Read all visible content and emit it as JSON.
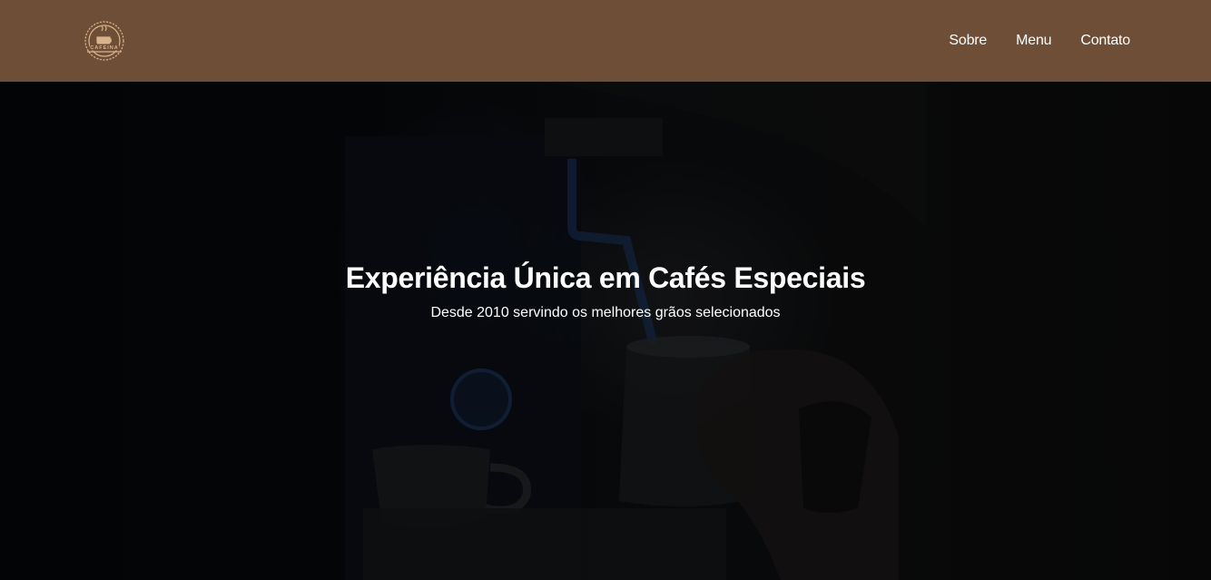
{
  "navbar": {
    "logo_icon": "cafeina-coffee-cup-badge-icon",
    "logo_text": "CAFEINA",
    "links": [
      {
        "label": "Sobre"
      },
      {
        "label": "Menu"
      },
      {
        "label": "Contato"
      }
    ],
    "background_color": "#6f4e37"
  },
  "hero": {
    "background_icon": "barista-espresso-photo",
    "title": "Experiência Única em Cafés Especiais",
    "subtitle": "Desde 2010 servindo os melhores grãos selecionados"
  }
}
